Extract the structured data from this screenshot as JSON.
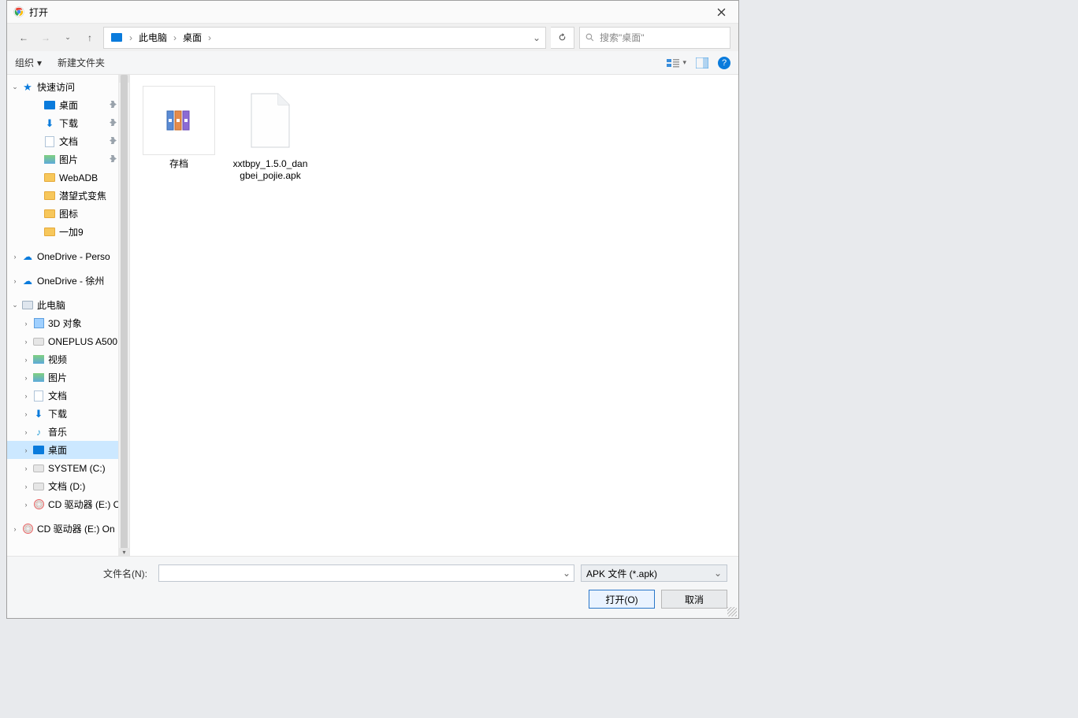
{
  "window": {
    "title": "打开"
  },
  "breadcrumbs": [
    "此电脑",
    "桌面"
  ],
  "search": {
    "placeholder": "搜索\"桌面\""
  },
  "toolbar": {
    "organize": "组织",
    "newfolder": "新建文件夹"
  },
  "sidebar": [
    {
      "label": "快速访问",
      "icon": "star",
      "exp": "▾",
      "indent": 0
    },
    {
      "label": "桌面",
      "icon": "blue",
      "indent": 2,
      "pin": true
    },
    {
      "label": "下载",
      "icon": "arrow",
      "indent": 2,
      "pin": true
    },
    {
      "label": "文档",
      "icon": "doc",
      "indent": 2,
      "pin": true
    },
    {
      "label": "图片",
      "icon": "pic",
      "indent": 2,
      "pin": true
    },
    {
      "label": "WebADB",
      "icon": "folder",
      "indent": 2
    },
    {
      "label": "潜望式变焦",
      "icon": "folder",
      "indent": 2
    },
    {
      "label": "图标",
      "icon": "folder",
      "indent": 2
    },
    {
      "label": "一加9",
      "icon": "folder",
      "indent": 2
    },
    {
      "label": "OneDrive - Perso",
      "icon": "cloud",
      "exp": "›",
      "indent": 0
    },
    {
      "label": "OneDrive - 徐州",
      "icon": "cloud",
      "exp": "›",
      "indent": 0
    },
    {
      "label": "此电脑",
      "icon": "monitor",
      "exp": "▾",
      "indent": 0
    },
    {
      "label": "3D 对象",
      "icon": "3d",
      "exp": "›",
      "indent": 1
    },
    {
      "label": "ONEPLUS A500",
      "icon": "drive",
      "exp": "›",
      "indent": 1
    },
    {
      "label": "视频",
      "icon": "pic",
      "exp": "›",
      "indent": 1
    },
    {
      "label": "图片",
      "icon": "pic",
      "exp": "›",
      "indent": 1
    },
    {
      "label": "文档",
      "icon": "doc",
      "exp": "›",
      "indent": 1
    },
    {
      "label": "下载",
      "icon": "arrow",
      "exp": "›",
      "indent": 1
    },
    {
      "label": "音乐",
      "icon": "music",
      "exp": "›",
      "indent": 1
    },
    {
      "label": "桌面",
      "icon": "blue",
      "exp": "›",
      "indent": 1,
      "selected": true
    },
    {
      "label": "SYSTEM (C:)",
      "icon": "drive",
      "exp": "›",
      "indent": 1
    },
    {
      "label": "文档 (D:)",
      "icon": "drive",
      "exp": "›",
      "indent": 1
    },
    {
      "label": "CD 驱动器 (E:) C",
      "icon": "cd",
      "exp": "›",
      "indent": 1
    },
    {
      "label": "CD 驱动器 (E:) On",
      "icon": "cd",
      "exp": "›",
      "indent": 0
    }
  ],
  "files": [
    {
      "label": "存档",
      "type": "folder"
    },
    {
      "label": "xxtbpy_1.5.0_dangbei_pojie.apk",
      "type": "file"
    }
  ],
  "footer": {
    "filename_label": "文件名(N):",
    "filetype": "APK 文件 (*.apk)",
    "open": "打开(O)",
    "cancel": "取消"
  }
}
